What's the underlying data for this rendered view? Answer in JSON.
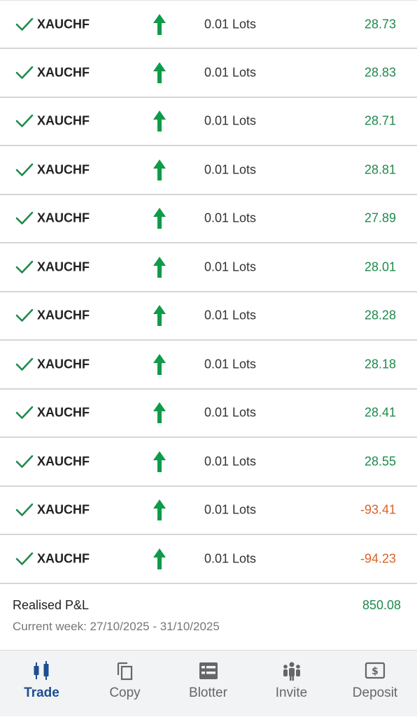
{
  "positions": [
    {
      "symbol": "XAUCHF",
      "lots": "0.01 Lots",
      "pnl": "28.73",
      "positive": true
    },
    {
      "symbol": "XAUCHF",
      "lots": "0.01 Lots",
      "pnl": "28.83",
      "positive": true
    },
    {
      "symbol": "XAUCHF",
      "lots": "0.01 Lots",
      "pnl": "28.71",
      "positive": true
    },
    {
      "symbol": "XAUCHF",
      "lots": "0.01 Lots",
      "pnl": "28.81",
      "positive": true
    },
    {
      "symbol": "XAUCHF",
      "lots": "0.01 Lots",
      "pnl": "27.89",
      "positive": true
    },
    {
      "symbol": "XAUCHF",
      "lots": "0.01 Lots",
      "pnl": "28.01",
      "positive": true
    },
    {
      "symbol": "XAUCHF",
      "lots": "0.01 Lots",
      "pnl": "28.28",
      "positive": true
    },
    {
      "symbol": "XAUCHF",
      "lots": "0.01 Lots",
      "pnl": "28.18",
      "positive": true
    },
    {
      "symbol": "XAUCHF",
      "lots": "0.01 Lots",
      "pnl": "28.41",
      "positive": true
    },
    {
      "symbol": "XAUCHF",
      "lots": "0.01 Lots",
      "pnl": "28.55",
      "positive": true
    },
    {
      "symbol": "XAUCHF",
      "lots": "0.01 Lots",
      "pnl": "-93.41",
      "positive": false
    },
    {
      "symbol": "XAUCHF",
      "lots": "0.01 Lots",
      "pnl": "-94.23",
      "positive": false
    }
  ],
  "summary": {
    "label": "Realised P&L",
    "value": "850.08",
    "week": "Current week: 27/10/2025 - 31/10/2025"
  },
  "nav": {
    "items": [
      {
        "label": "Trade",
        "icon": "candlestick-icon",
        "active": true
      },
      {
        "label": "Copy",
        "icon": "copy-icon",
        "active": false
      },
      {
        "label": "Blotter",
        "icon": "blotter-icon",
        "active": false
      },
      {
        "label": "Invite",
        "icon": "people-icon",
        "active": false
      },
      {
        "label": "Deposit",
        "icon": "deposit-icon",
        "active": false
      }
    ]
  },
  "colors": {
    "positive": "#1f8a4c",
    "negative": "#d9622b",
    "arrow": "#0f9b4a",
    "active_nav": "#1d4e91",
    "inactive_nav": "#666666"
  }
}
